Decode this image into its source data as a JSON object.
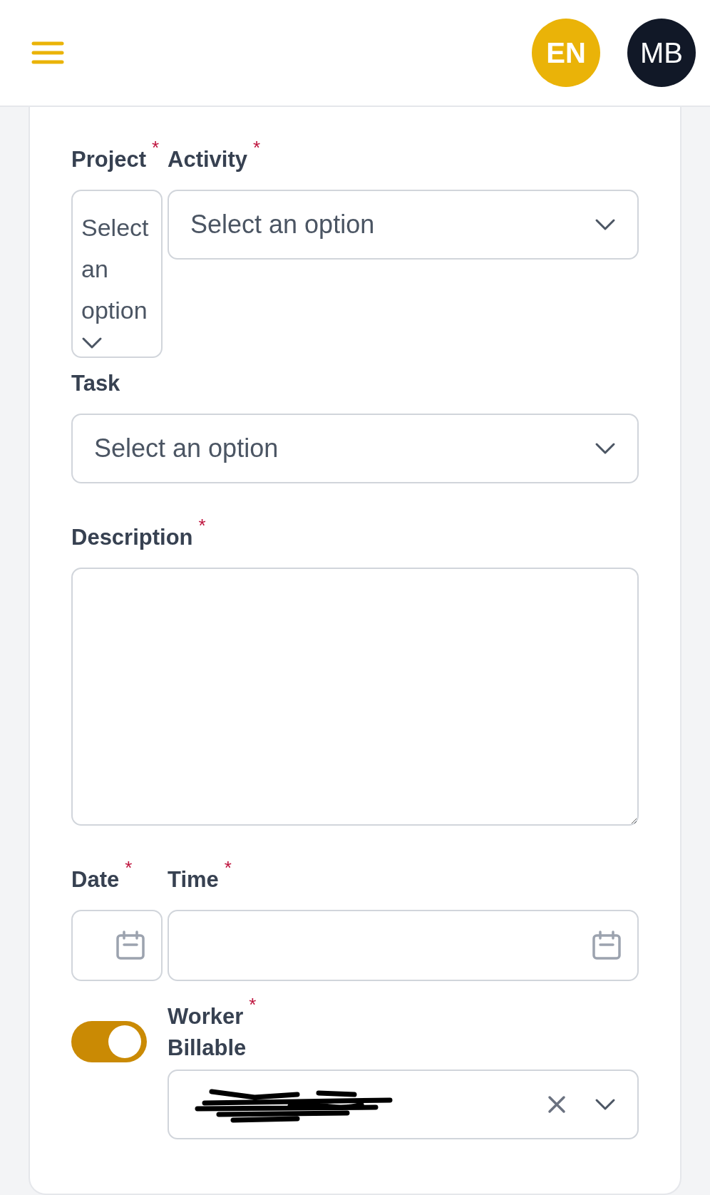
{
  "header": {
    "language": "EN",
    "avatar": "MB"
  },
  "form": {
    "project": {
      "label": "Project",
      "required_mark": "*",
      "placeholder": "Select an option"
    },
    "activity": {
      "label": "Activity",
      "required_mark": "*",
      "placeholder": "Select an option"
    },
    "task": {
      "label": "Task",
      "placeholder": "Select an option"
    },
    "description": {
      "label": "Description",
      "required_mark": "*"
    },
    "date": {
      "label": "Date",
      "required_mark": "*"
    },
    "time": {
      "label": "Time",
      "required_mark": "*"
    },
    "billable": {
      "label": "Billable",
      "on": true
    },
    "worker": {
      "label": "Worker",
      "required_mark": "*"
    }
  }
}
